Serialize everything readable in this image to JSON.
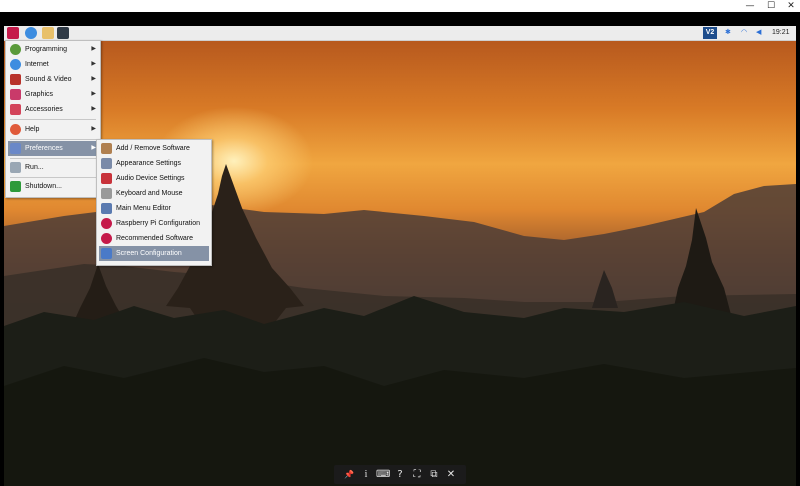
{
  "window": {
    "controls": {
      "minimize": "—",
      "maximize": "☐",
      "close": "✕"
    }
  },
  "taskbar": {
    "launchers": [
      "raspberry-icon",
      "globe-icon",
      "folder-icon",
      "terminal-icon"
    ],
    "tray": {
      "vnc": "V2",
      "clock": "19:21"
    }
  },
  "main_menu": {
    "items": [
      {
        "label": "Programming"
      },
      {
        "label": "Internet"
      },
      {
        "label": "Sound & Video"
      },
      {
        "label": "Graphics"
      },
      {
        "label": "Accessories"
      },
      {
        "label": "Help"
      },
      {
        "label": "Preferences"
      },
      {
        "label": "Run..."
      },
      {
        "label": "Shutdown..."
      }
    ]
  },
  "preferences_menu": {
    "items": [
      {
        "label": "Add / Remove Software"
      },
      {
        "label": "Appearance Settings"
      },
      {
        "label": "Audio Device Settings"
      },
      {
        "label": "Keyboard and Mouse"
      },
      {
        "label": "Main Menu Editor"
      },
      {
        "label": "Raspberry Pi Configuration"
      },
      {
        "label": "Recommended Software"
      },
      {
        "label": "Screen Configuration"
      }
    ]
  },
  "viewer_toolbar": {
    "buttons": {
      "pin": "📌",
      "info": "i",
      "keyboard": "⌨",
      "help": "?",
      "fullscreen": "⛶",
      "scale": "⧉",
      "close": "✕"
    }
  }
}
